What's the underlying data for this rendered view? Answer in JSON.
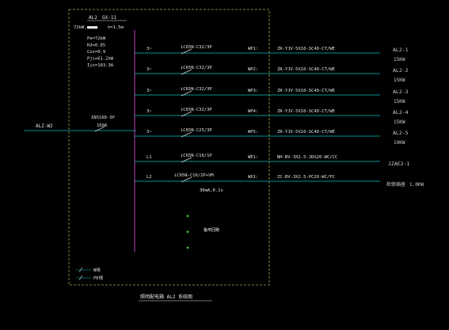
{
  "panel": {
    "name": "AL2",
    "model": "GX-11",
    "power_line": "72kW,",
    "install": "h=1.5m",
    "params": [
      "Pe=72kW",
      "Kd=0.85",
      "Cos=0.9",
      "Pjs=61.2kW",
      "Ijs=103.3A"
    ]
  },
  "incoming": {
    "source": "ALZ-W2",
    "breaker": "INS160-3P",
    "rating": "160A"
  },
  "circuits": [
    {
      "phase": "3~",
      "breaker": "iC65N-C32/3P",
      "code": "WP1:",
      "cable": "ZR-YJV-5X10-SC40-CT/WE",
      "dest": "AL2-1",
      "load": "15KW"
    },
    {
      "phase": "3~",
      "breaker": "iC65N-C32/3P",
      "code": "WP2:",
      "cable": "ZR-YJV-5X10-SC40-CT/WE",
      "dest": "AL2-2",
      "load": "15KW"
    },
    {
      "phase": "3~",
      "breaker": "iC65N-C32/3P",
      "code": "WP3:",
      "cable": "ZR-YJV-5X10-SC40-CT/WE",
      "dest": "AL2-3",
      "load": "15KW"
    },
    {
      "phase": "3~",
      "breaker": "iC65N-C32/3P",
      "code": "WP4:",
      "cable": "ZR-YJV-5X10-SC40-CT/WE",
      "dest": "AL2-4",
      "load": "15KW"
    },
    {
      "phase": "3~",
      "breaker": "iC65N-C25/3P",
      "code": "WP5:",
      "cable": "ZR-YJV-5X10-SC40-CT/WE",
      "dest": "AL2-5",
      "load": "10KW"
    },
    {
      "phase": "L1",
      "breaker": "iC65N-C16/1P",
      "code": "WE1:",
      "cable": "NH-BV-3X2.5-JDG20-WC/CC",
      "dest": "JZAE2-1",
      "load": ""
    },
    {
      "phase": "L2",
      "breaker": "iC65N-C16/2P+VM",
      "breaker_note": "30mA,0.1s",
      "code": "WX1:",
      "cable": "ZC-BV-3X2.5-PC20-WC/FC",
      "dest": "检修插座",
      "load": "1.0KW"
    }
  ],
  "spare_note": "备用回路",
  "legend": [
    "N线",
    "PE线"
  ],
  "title": "照明配电箱  AL2 系统图",
  "colors": {
    "frame": "#a8a850",
    "bus": "#c040c0",
    "feeder": "#00c0c0",
    "text": "#e6e6e6",
    "label": "#cfcfcf",
    "breaker": "#d8d8d8",
    "dot": "#3ec03e"
  }
}
